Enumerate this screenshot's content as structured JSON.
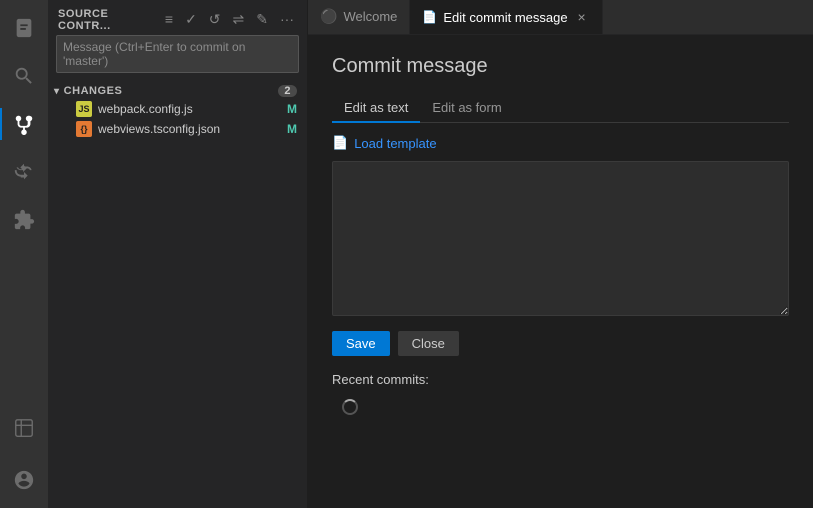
{
  "activityBar": {
    "icons": [
      {
        "name": "explorer-icon",
        "symbol": "⎘",
        "active": false
      },
      {
        "name": "search-icon",
        "symbol": "🔍",
        "active": false
      },
      {
        "name": "source-control-icon",
        "symbol": "⑂",
        "active": true
      },
      {
        "name": "run-icon",
        "symbol": "▷",
        "active": false
      },
      {
        "name": "extensions-icon",
        "symbol": "⊞",
        "active": false
      },
      {
        "name": "test-icon",
        "symbol": "⚗",
        "active": false
      },
      {
        "name": "account-icon",
        "symbol": "◉",
        "active": false
      }
    ]
  },
  "sidebar": {
    "title": "Source Contr...",
    "icons": [
      "≡",
      "✓",
      "↺",
      "⇌",
      "✎",
      "···"
    ],
    "commitInputPlaceholder": "Message (Ctrl+Enter to commit on 'master')",
    "changesSection": {
      "label": "CHANGES",
      "count": "2",
      "files": [
        {
          "name": "webpack.config.js",
          "ext": "js",
          "status": "M"
        },
        {
          "name": "webviews.tsconfig.json",
          "ext": "json",
          "status": "M"
        }
      ]
    }
  },
  "tabs": [
    {
      "id": "welcome",
      "label": "Welcome",
      "icon": "vs",
      "active": false,
      "closable": false
    },
    {
      "id": "edit-commit",
      "label": "Edit commit message",
      "icon": "edit",
      "active": true,
      "closable": true
    }
  ],
  "editor": {
    "title": "Commit message",
    "subtabs": [
      {
        "id": "edit-text",
        "label": "Edit as text",
        "active": true
      },
      {
        "id": "edit-form",
        "label": "Edit as form",
        "active": false
      }
    ],
    "loadTemplateLabel": "Load template",
    "commitTextareaPlaceholder": "",
    "saveButton": "Save",
    "closeButton": "Close",
    "recentCommitsLabel": "Recent commits:"
  }
}
